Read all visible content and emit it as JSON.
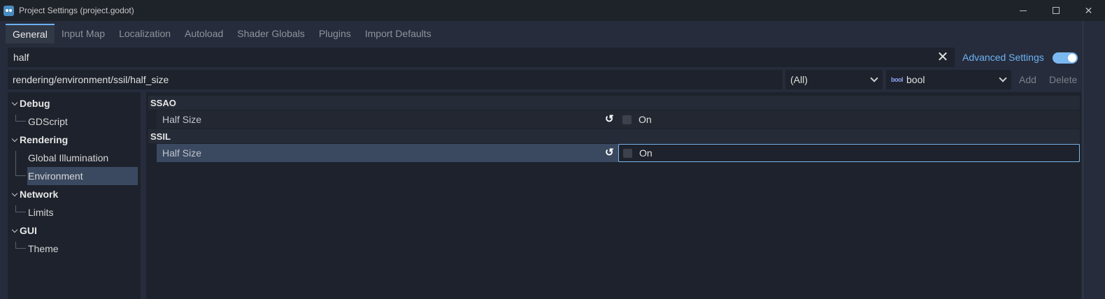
{
  "window": {
    "title": "Project Settings (project.godot)",
    "controls": {
      "minimize": "",
      "maximize": "",
      "close": "✕"
    }
  },
  "tabs": [
    {
      "label": "General",
      "active": true
    },
    {
      "label": "Input Map",
      "active": false
    },
    {
      "label": "Localization",
      "active": false
    },
    {
      "label": "Autoload",
      "active": false
    },
    {
      "label": "Shader Globals",
      "active": false
    },
    {
      "label": "Plugins",
      "active": false
    },
    {
      "label": "Import Defaults",
      "active": false
    }
  ],
  "search": {
    "value": "half",
    "clear_icon": "✕"
  },
  "advanced": {
    "label": "Advanced Settings",
    "enabled": true
  },
  "property_path": {
    "value": "rendering/environment/ssil/half_size"
  },
  "filter_dropdown": {
    "value": "(All)"
  },
  "type_dropdown": {
    "icon": "bool",
    "value": "bool"
  },
  "actions": {
    "add": "Add",
    "delete": "Delete"
  },
  "tree": {
    "categories": [
      {
        "label": "Debug",
        "items": [
          "GDScript"
        ]
      },
      {
        "label": "Rendering",
        "items": [
          "Global Illumination",
          "Environment"
        ]
      },
      {
        "label": "Network",
        "items": [
          "Limits"
        ]
      },
      {
        "label": "GUI",
        "items": [
          "Theme"
        ]
      }
    ],
    "selected": "Environment"
  },
  "sections": [
    {
      "title": "SSAO",
      "properties": [
        {
          "label": "Half Size",
          "value": "On",
          "checked": false
        }
      ]
    },
    {
      "title": "SSIL",
      "properties": [
        {
          "label": "Half Size",
          "value": "On",
          "checked": false
        }
      ]
    }
  ],
  "colors": {
    "accent": "#6eb3f5",
    "selection": "#3a4960",
    "background": "#1d222c"
  }
}
